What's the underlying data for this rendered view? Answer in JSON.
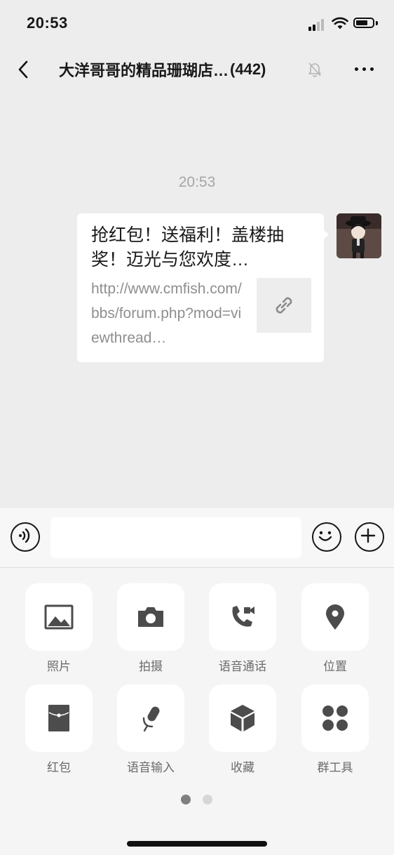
{
  "status_bar": {
    "time": "20:53"
  },
  "nav": {
    "title": "大洋哥哥的精品珊瑚店…",
    "member_count": "(442)"
  },
  "chat": {
    "timestamp": "20:53",
    "message": {
      "title": "抢红包！送福利！盖楼抽奖！迈光与您欢度…",
      "url": "http://www.cmfish.com/bbs/forum.php?mod=viewthread…"
    }
  },
  "input": {
    "value": "",
    "placeholder": ""
  },
  "actions": [
    {
      "label": "照片",
      "icon": "photo-icon"
    },
    {
      "label": "拍摄",
      "icon": "camera-icon"
    },
    {
      "label": "语音通话",
      "icon": "voice-call-icon"
    },
    {
      "label": "位置",
      "icon": "location-icon"
    },
    {
      "label": "红包",
      "icon": "red-packet-icon"
    },
    {
      "label": "语音输入",
      "icon": "microphone-icon"
    },
    {
      "label": "收藏",
      "icon": "favorites-icon"
    },
    {
      "label": "群工具",
      "icon": "group-tools-icon"
    }
  ],
  "pager": {
    "pages": 2,
    "current": 1
  },
  "colors": {
    "background": "#ededed",
    "panel": "#f5f5f5",
    "bubble": "#ffffff",
    "icon": "#4c4c4c"
  }
}
